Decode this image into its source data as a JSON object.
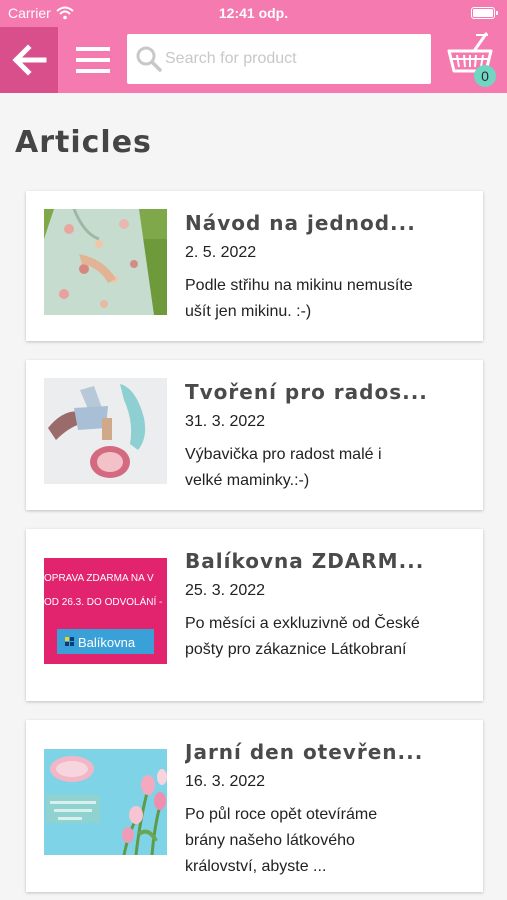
{
  "status_bar": {
    "carrier": "Carrier",
    "time": "12:41 odp."
  },
  "nav": {
    "search_placeholder": "Search for product",
    "cart_count": "0"
  },
  "page": {
    "title": "Articles"
  },
  "articles": [
    {
      "title": "Návod na jednod...",
      "date": "2. 5. 2022",
      "excerpt": "Podle střihu na mikinu nemusíte ušít jen mikinu. :-)"
    },
    {
      "title": "Tvoření pro rados...",
      "date": "31. 3. 2022",
      "excerpt": "Výbavička pro radost malé i velké maminky.:-)"
    },
    {
      "title": "Balíkovna ZDARM...",
      "date": "25. 3. 2022",
      "excerpt": "Po měsíci a exkluzivně od České pošty pro zákaznice Látkobraní",
      "thumb_text": [
        "OPRAVA ZDARMA NA V",
        "OD 26.3. DO ODVOLÁNÍ -",
        "Balíkovna"
      ]
    },
    {
      "title": "Jarní den otevřen...",
      "date": "16. 3. 2022",
      "excerpt": "Po půl roce opět otevíráme brány našeho látkového království, abyste ..."
    }
  ],
  "colors": {
    "brand_pink": "#f47ab0",
    "back_button": "#d94f8c",
    "badge": "#6fd6c4"
  },
  "icons": [
    "wifi-icon",
    "battery-icon",
    "back-arrow-icon",
    "hamburger-menu-icon",
    "search-icon",
    "basket-icon"
  ]
}
